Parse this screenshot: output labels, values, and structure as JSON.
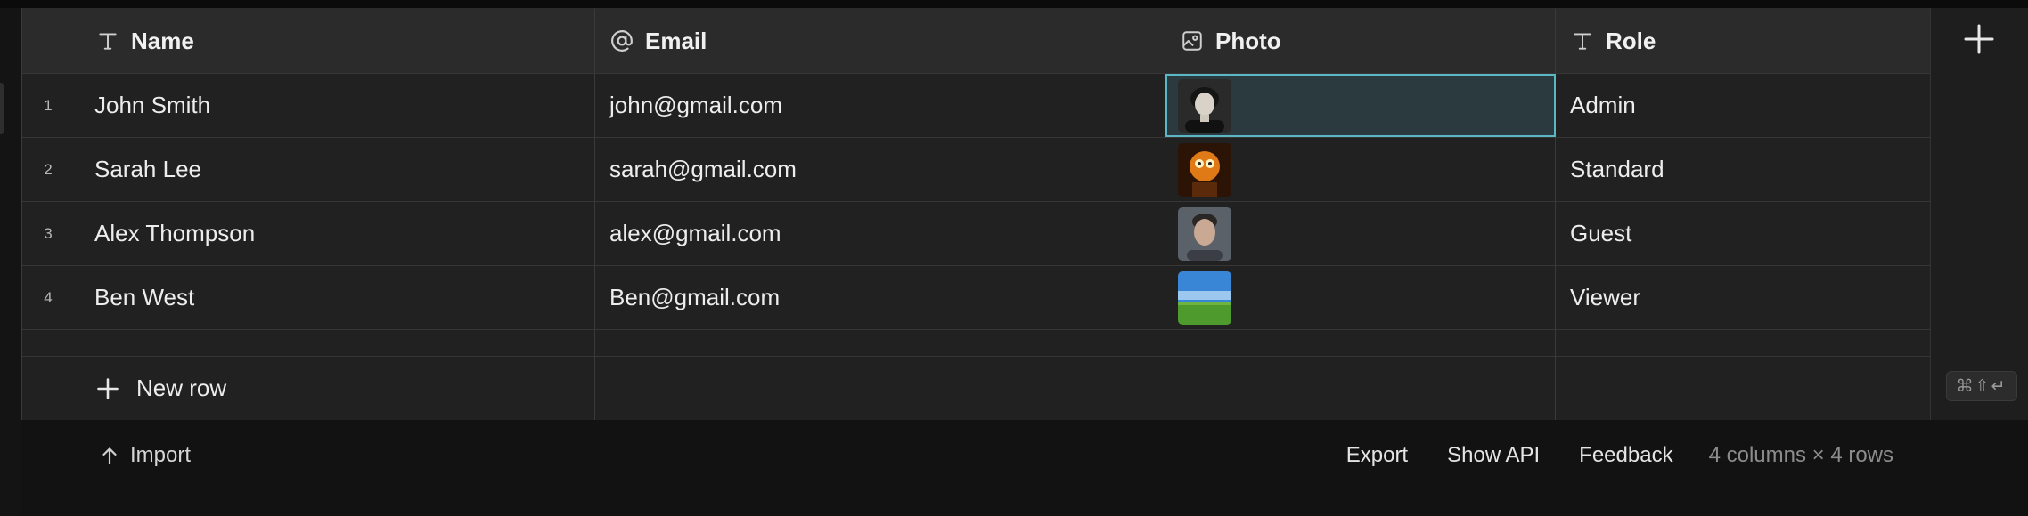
{
  "columns": [
    {
      "label": "Name",
      "icon": "text-type-icon"
    },
    {
      "label": "Email",
      "icon": "at-sign-icon"
    },
    {
      "label": "Photo",
      "icon": "image-icon"
    },
    {
      "label": "Role",
      "icon": "text-type-icon"
    }
  ],
  "rows": [
    {
      "num": "1",
      "name": "John Smith",
      "email": "john@gmail.com",
      "photo": "portrait-man-curly-hair",
      "role": "Admin"
    },
    {
      "num": "2",
      "name": "Sarah Lee",
      "email": "sarah@gmail.com",
      "photo": "orange-cartoon-character",
      "role": "Standard"
    },
    {
      "num": "3",
      "name": "Alex Thompson",
      "email": "alex@gmail.com",
      "photo": "portrait-man-short-hair",
      "role": "Guest"
    },
    {
      "num": "4",
      "name": "Ben West",
      "email": "Ben@gmail.com",
      "photo": "landscape-sky-field",
      "role": "Viewer"
    }
  ],
  "new_row_label": "New row",
  "keyboard_hint": "⌘⇧↵",
  "footer": {
    "import_label": "Import",
    "export_label": "Export",
    "show_api_label": "Show API",
    "feedback_label": "Feedback",
    "summary": "4 columns × 4 rows"
  },
  "colors": {
    "selection_outline": "#5bb7c4",
    "grid_background": "#212121",
    "header_background": "#2b2b2b"
  }
}
